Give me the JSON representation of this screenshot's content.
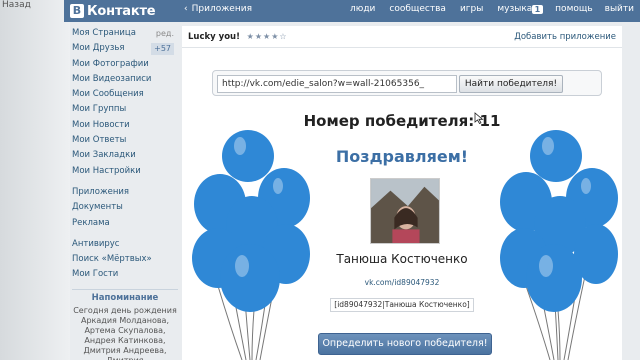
{
  "browser": {
    "back_label": "Назад"
  },
  "header": {
    "logo_letter": "В",
    "logo_text": "Контакте",
    "crumb_arrow": "‹",
    "crumb_label": "Приложения",
    "nav": [
      "люди",
      "сообщества",
      "игры",
      "музыка"
    ],
    "badge": "1",
    "help": "помощь",
    "logout": "выйти"
  },
  "sidebar": {
    "items": [
      {
        "label": "Моя Страница",
        "extra": "ред."
      },
      {
        "label": "Мои Друзья",
        "count": "+57"
      },
      {
        "label": "Мои Фотографии"
      },
      {
        "label": "Мои Видеозаписи"
      },
      {
        "label": "Мои Сообщения"
      },
      {
        "label": "Мои Группы"
      },
      {
        "label": "Мои Новости"
      },
      {
        "label": "Мои Ответы"
      },
      {
        "label": "Мои Закладки"
      },
      {
        "label": "Мои Настройки"
      }
    ],
    "items2": [
      "Приложения",
      "Документы",
      "Реклама"
    ],
    "items3": [
      "Антивирус",
      "Поиск «Мёртвых»",
      "Мои Гости"
    ],
    "reminder_title": "Напоминание",
    "reminder_text": "Сегодня день рождения Аркадия Молданова, Артема Скупалова, Андрея Катинкова, Дмитрия Андреева, Дмитрия"
  },
  "app": {
    "name": "Lucky you!",
    "stars": "★★★★☆",
    "add_app": "Добавить приложение",
    "url_value": "http://vk.com/edie_salon?w=wall-21065356_",
    "find_button": "Найти победителя!",
    "winner_number_label": "Номер победителя: 11",
    "congrats": "Поздравляем!",
    "winner_name": "Танюша Костюченко",
    "winner_link": "vk.com/id89047932",
    "bbcode": "[id89047932|Танюша Костюченко]",
    "new_winner_button": "Определить нового победителя!"
  },
  "colors": {
    "header": "#4e729a",
    "balloon": "#2f88d6",
    "accent": "#3c6fa5"
  }
}
